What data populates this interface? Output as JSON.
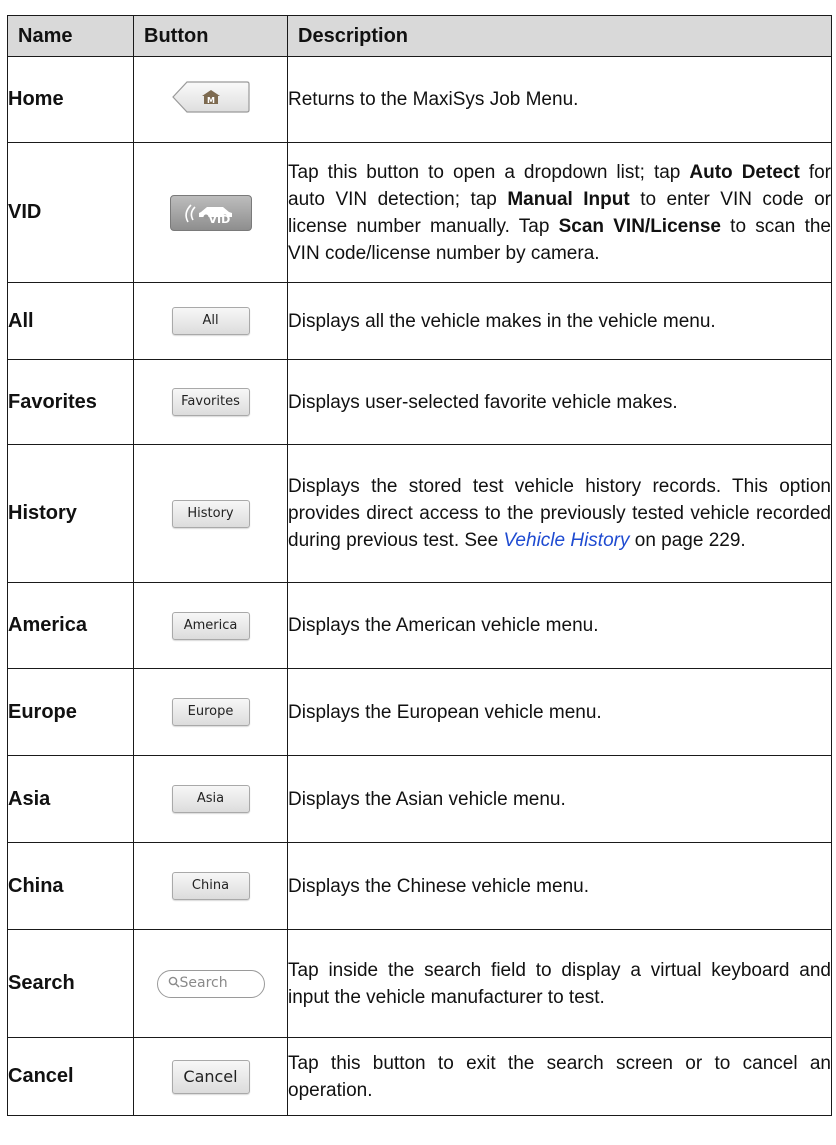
{
  "headers": {
    "name": "Name",
    "button": "Button",
    "description": "Description"
  },
  "rows": [
    {
      "name": "Home",
      "desc": "Returns to the MaxiSys Job Menu.",
      "icon": "home-m-icon"
    },
    {
      "name": "VID",
      "icon": "vid-car-icon",
      "desc_parts": [
        "Tap this button to open a dropdown list; tap ",
        "Auto Detect",
        " for auto VIN detection; tap ",
        "Manual Input",
        " to enter VIN code or license number manually. Tap ",
        "Scan VIN/License",
        " to scan the VIN code/license number by camera."
      ],
      "icon_text": "VID"
    },
    {
      "name": "All",
      "btn": "All",
      "desc": "Displays all the vehicle makes in the vehicle menu."
    },
    {
      "name": "Favorites",
      "btn": "Favorites",
      "desc": "Displays user-selected favorite vehicle makes."
    },
    {
      "name": "History",
      "btn": "History",
      "desc_parts": [
        "Displays the stored test vehicle history records. This option provides direct access to the previously tested vehicle recorded during previous test. See ",
        "Vehicle History",
        " on page 229."
      ]
    },
    {
      "name": "America",
      "btn": "America",
      "desc": "Displays the American vehicle menu."
    },
    {
      "name": "Europe",
      "btn": "Europe",
      "desc": "Displays the European vehicle menu."
    },
    {
      "name": "Asia",
      "btn": "Asia",
      "desc": "Displays the Asian vehicle menu."
    },
    {
      "name": "China",
      "btn": "China",
      "desc": "Displays the Chinese vehicle menu."
    },
    {
      "name": "Search",
      "btn": "Search",
      "icon": "search-icon",
      "desc": "Tap inside the search field to display a virtual keyboard and input the vehicle manufacturer to test."
    },
    {
      "name": "Cancel",
      "btn": "Cancel",
      "desc": "Tap this button to exit the search screen or to cancel an operation."
    }
  ],
  "colors": {
    "header_bg": "#d9d9d9",
    "link": "#1f4bd1",
    "border": "#1a1a1a"
  }
}
